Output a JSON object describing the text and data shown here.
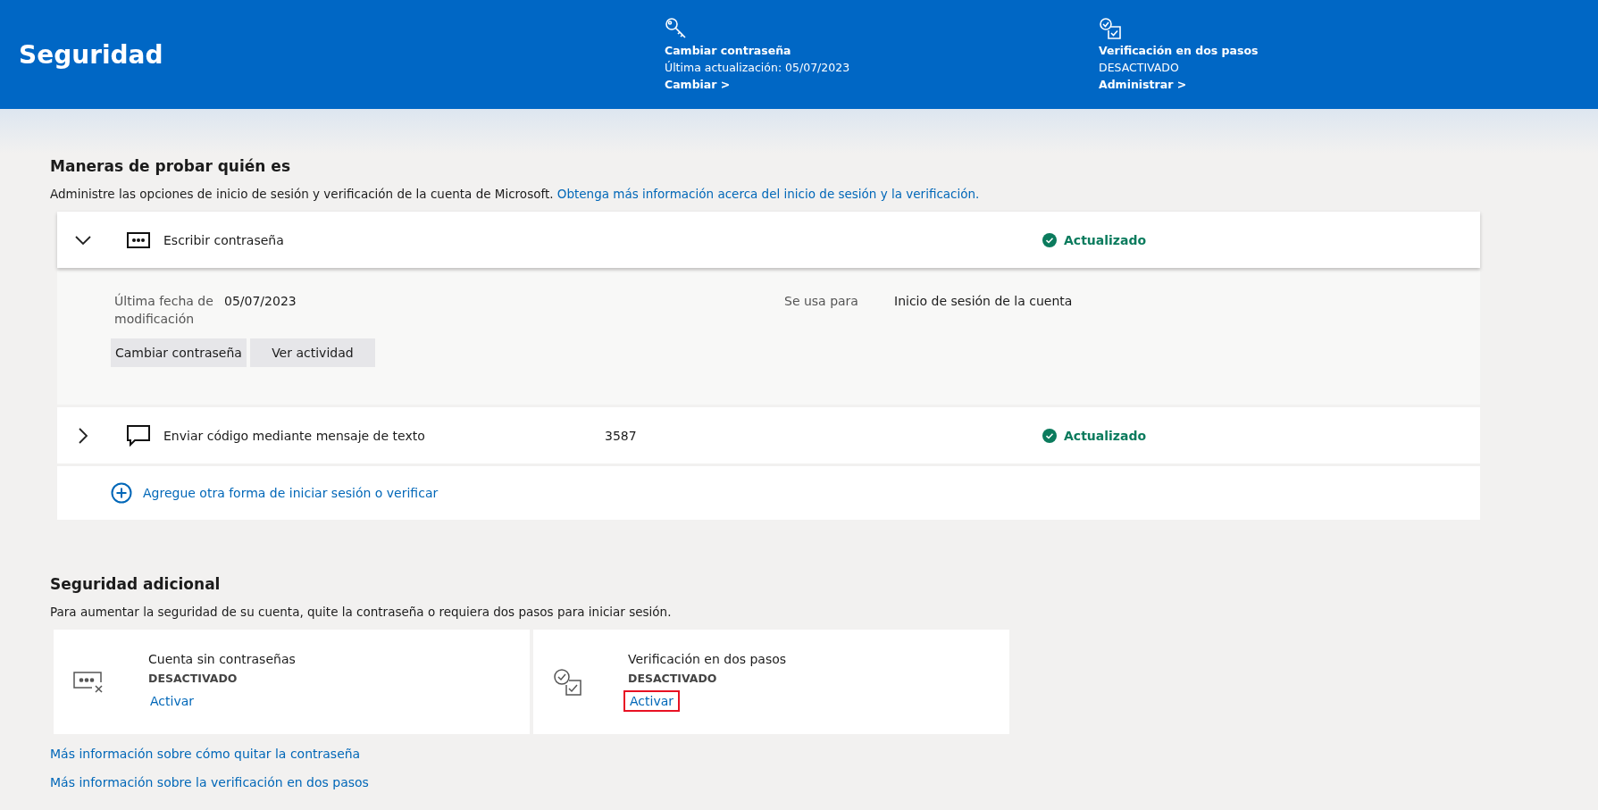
{
  "header": {
    "title": "Seguridad",
    "items": [
      {
        "kind": "key",
        "title": "Cambiar contraseña",
        "subtitle": "Última actualización: 05/07/2023",
        "link": "Cambiar >"
      },
      {
        "kind": "verify",
        "title": "Verificación en dos pasos",
        "subtitle": "DESACTIVADO",
        "link": "Administrar >"
      }
    ]
  },
  "proof_section": {
    "title": "Maneras de probar quién es",
    "description": "Administre las opciones de inicio de sesión y verificación de la cuenta de Microsoft.",
    "link": "Obtenga más información acerca del inicio de sesión y la verificación.",
    "methods": [
      {
        "kind": "password",
        "name": "Escribir contraseña",
        "status": "Actualizado",
        "expanded": true,
        "details": [
          {
            "label": "Última fecha de modificación",
            "value": "05/07/2023"
          },
          {
            "label": "Se usa para",
            "value": "Inicio de sesión de la cuenta"
          }
        ],
        "buttons": [
          "Cambiar contraseña",
          "Ver actividad"
        ]
      },
      {
        "kind": "sms",
        "name": "Enviar código mediante mensaje de texto",
        "value": "3587",
        "status": "Actualizado",
        "expanded": false
      }
    ],
    "add_link": "Agregue otra forma de iniciar sesión o verificar"
  },
  "extra_section": {
    "title": "Seguridad adicional",
    "description": "Para aumentar la seguridad de su cuenta, quite la contraseña o requiera dos pasos para iniciar sesión.",
    "cards": [
      {
        "kind": "passwordless",
        "title": "Cuenta sin contraseñas",
        "status": "DESACTIVADO",
        "action": "Activar",
        "highlighted": false
      },
      {
        "kind": "verify",
        "title": "Verificación en dos pasos",
        "status": "DESACTIVADO",
        "action": "Activar",
        "highlighted": true
      }
    ],
    "links": [
      "Más información sobre cómo quitar la contraseña",
      "Más información sobre la verificación en dos pasos"
    ]
  }
}
